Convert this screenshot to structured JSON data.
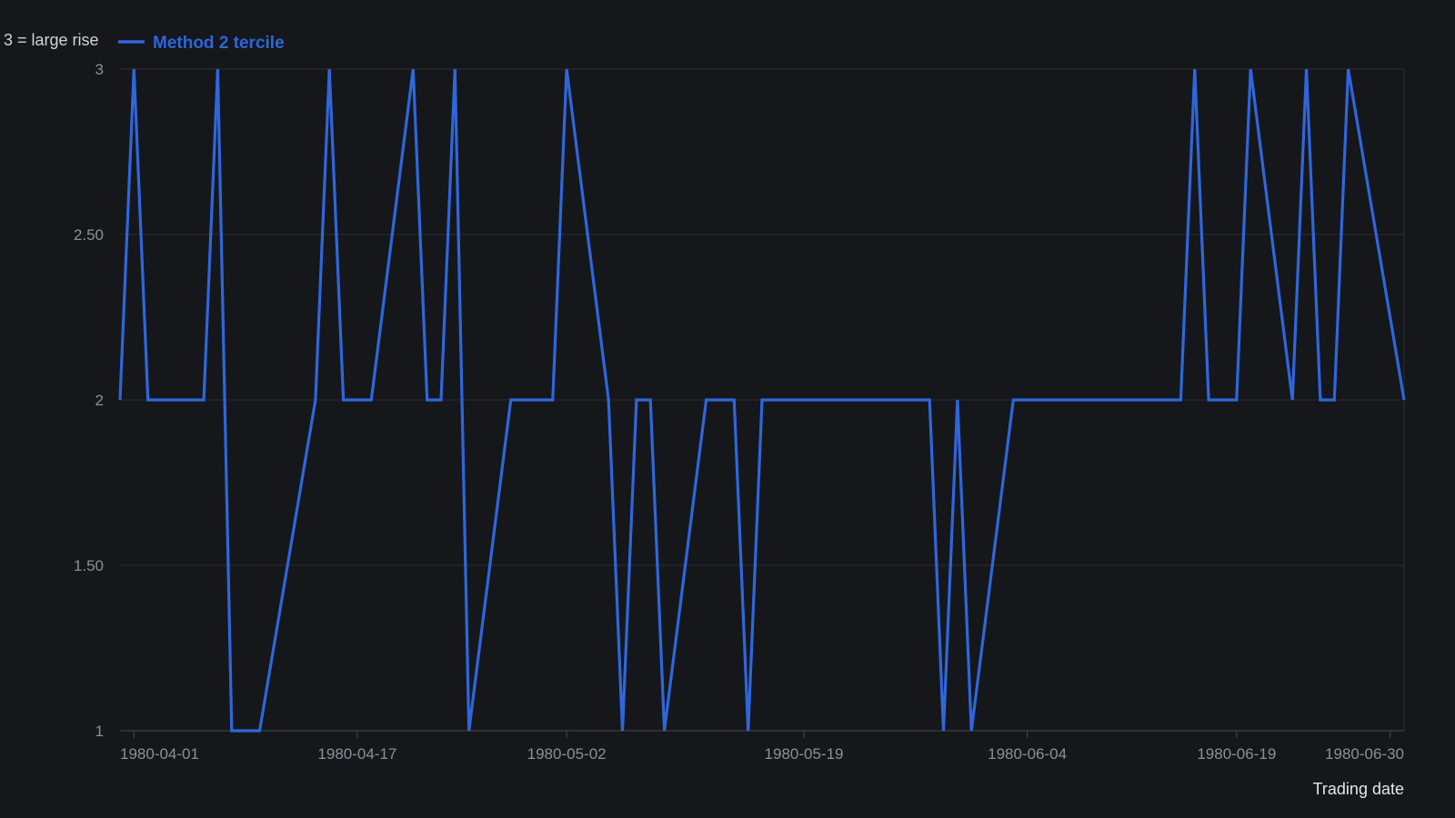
{
  "chart_data": {
    "type": "line",
    "title": "",
    "xlabel": "Trading date",
    "ylabel": "3 = large rise",
    "ylim": [
      1,
      3
    ],
    "yticks": [
      1,
      1.5,
      2,
      2.5,
      3
    ],
    "ytick_labels": [
      "1",
      "1.50",
      "2",
      "2.50",
      "3"
    ],
    "xlim": [
      "1980-03-31",
      "1980-07-01"
    ],
    "xticks": [
      "1980-04-01",
      "1980-04-17",
      "1980-05-02",
      "1980-05-19",
      "1980-06-04",
      "1980-06-19",
      "1980-06-30"
    ],
    "grid": true,
    "legend_position": "top-left",
    "colors": {
      "line": "#2f66dc",
      "background": "#15171b"
    },
    "series": [
      {
        "name": "Method 2 tercile",
        "points": [
          [
            "1980-03-31",
            2
          ],
          [
            "1980-04-01",
            3
          ],
          [
            "1980-04-02",
            2
          ],
          [
            "1980-04-03",
            2
          ],
          [
            "1980-04-04",
            2
          ],
          [
            "1980-04-05",
            2
          ],
          [
            "1980-04-06",
            2
          ],
          [
            "1980-04-07",
            3
          ],
          [
            "1980-04-08",
            1
          ],
          [
            "1980-04-09",
            1
          ],
          [
            "1980-04-10",
            1
          ],
          [
            "1980-04-14",
            2
          ],
          [
            "1980-04-15",
            3
          ],
          [
            "1980-04-16",
            2
          ],
          [
            "1980-04-17",
            2
          ],
          [
            "1980-04-18",
            2
          ],
          [
            "1980-04-21",
            3
          ],
          [
            "1980-04-22",
            2
          ],
          [
            "1980-04-23",
            2
          ],
          [
            "1980-04-24",
            3
          ],
          [
            "1980-04-25",
            1
          ],
          [
            "1980-04-28",
            2
          ],
          [
            "1980-04-29",
            2
          ],
          [
            "1980-04-30",
            2
          ],
          [
            "1980-05-01",
            2
          ],
          [
            "1980-05-02",
            3
          ],
          [
            "1980-05-05",
            2
          ],
          [
            "1980-05-06",
            1
          ],
          [
            "1980-05-07",
            2
          ],
          [
            "1980-05-08",
            2
          ],
          [
            "1980-05-09",
            1
          ],
          [
            "1980-05-12",
            2
          ],
          [
            "1980-05-13",
            2
          ],
          [
            "1980-05-14",
            2
          ],
          [
            "1980-05-15",
            1
          ],
          [
            "1980-05-16",
            2
          ],
          [
            "1980-05-19",
            2
          ],
          [
            "1980-05-20",
            2
          ],
          [
            "1980-05-21",
            2
          ],
          [
            "1980-05-22",
            2
          ],
          [
            "1980-05-23",
            2
          ],
          [
            "1980-05-27",
            2
          ],
          [
            "1980-05-28",
            2
          ],
          [
            "1980-05-29",
            1
          ],
          [
            "1980-05-30",
            2
          ],
          [
            "1980-05-31",
            1
          ],
          [
            "1980-06-03",
            2
          ],
          [
            "1980-06-04",
            2
          ],
          [
            "1980-06-05",
            2
          ],
          [
            "1980-06-06",
            2
          ],
          [
            "1980-06-09",
            2
          ],
          [
            "1980-06-10",
            2
          ],
          [
            "1980-06-11",
            2
          ],
          [
            "1980-06-12",
            2
          ],
          [
            "1980-06-15",
            2
          ],
          [
            "1980-06-16",
            3
          ],
          [
            "1980-06-17",
            2
          ],
          [
            "1980-06-18",
            2
          ],
          [
            "1980-06-19",
            2
          ],
          [
            "1980-06-20",
            3
          ],
          [
            "1980-06-23",
            2
          ],
          [
            "1980-06-24",
            3
          ],
          [
            "1980-06-25",
            2
          ],
          [
            "1980-06-26",
            2
          ],
          [
            "1980-06-27",
            3
          ],
          [
            "1980-07-01",
            2
          ]
        ]
      }
    ]
  }
}
